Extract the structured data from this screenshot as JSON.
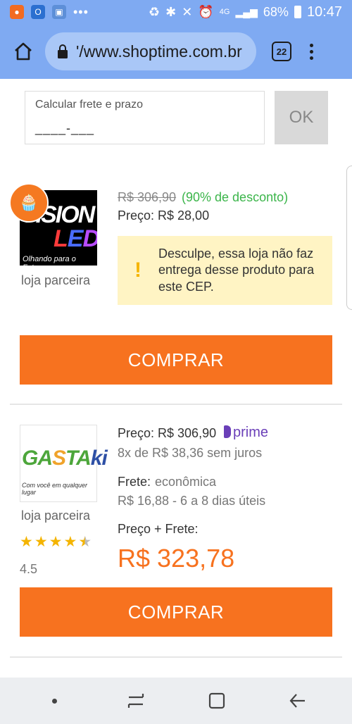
{
  "status_bar": {
    "battery": "68%",
    "time": "10:47",
    "network": "4G"
  },
  "browser": {
    "url": "'/www.shoptime.com.br",
    "tab_count": "22"
  },
  "shipping": {
    "placeholder": "Calcular frete e prazo",
    "cep_value": "____-___",
    "ok_label": "OK"
  },
  "offers": [
    {
      "seller_type": "loja parceira",
      "badge": "aniversário",
      "old_price": "R$ 306,90",
      "discount": "(90% de desconto)",
      "price": "Preço: R$ 28,00",
      "warning": "Desculpe, essa loja não faz entrega desse produto para este CEP.",
      "buy_label": "COMPRAR",
      "logo": {
        "line1": "VISION",
        "led_l": "L",
        "led_e": "E",
        "led_d": "D",
        "tagline": "Olhando para o Futuro"
      }
    },
    {
      "seller_type": "loja parceira",
      "price": "Preço: R$ 306,90",
      "prime": "prime",
      "installments": "8x de R$ 38,36 sem juros",
      "shipping_label": "Frete:",
      "shipping_type": "econômica",
      "shipping_detail": "R$ 16,88 - 6 a 8 dias úteis",
      "total_label": "Preço + Frete:",
      "total_value": "R$ 323,78",
      "rating": "4.5",
      "rating_value": 4.5,
      "buy_label": "COMPRAR",
      "logo": {
        "part_a": "GA",
        "part_b": "S",
        "part_c": "TA",
        "part_d": "ki",
        "tagline": "Com você em qualquer lugar"
      }
    }
  ],
  "colors": {
    "accent": "#f7721f",
    "header": "#7faaf2",
    "discount": "#3bb54a",
    "prime": "#6a3fb8",
    "warning_bg": "#fff4c4"
  }
}
